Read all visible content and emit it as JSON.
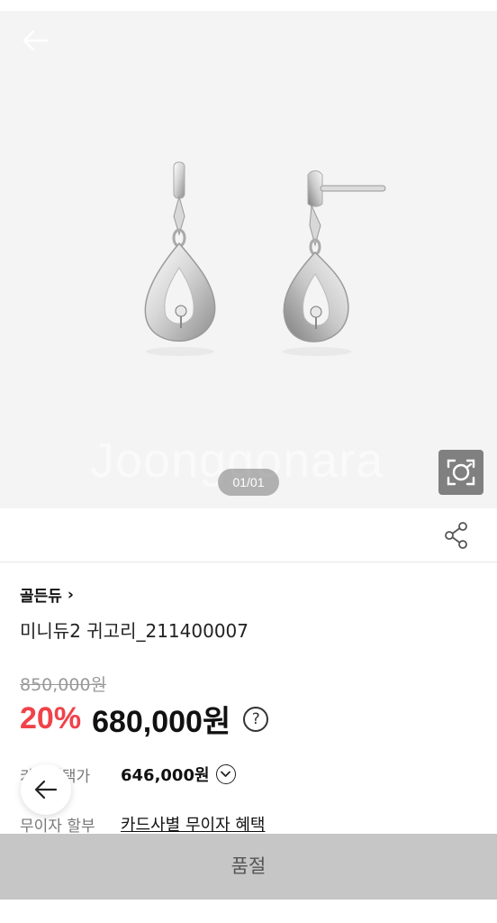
{
  "gallery": {
    "counter": "01/01",
    "watermark": "Joonggonara"
  },
  "product": {
    "brand": "골든듀",
    "brand_chevron": "›",
    "name": "미니듀2 귀고리_211400007"
  },
  "pricing": {
    "original": "850,000원",
    "discount": "20%",
    "sale": "680,000원",
    "help": "?"
  },
  "card_benefit": {
    "label": "카드혜택가",
    "price": "646,000원"
  },
  "installment": {
    "label": "무이자 할부",
    "link": "카드사별 무이자 혜택"
  },
  "footer": {
    "soldout": "품절"
  },
  "colors": {
    "discount": "#f0424a",
    "soldout_bg": "#c6c6c6",
    "gallery_bg": "#f4f4f4"
  }
}
